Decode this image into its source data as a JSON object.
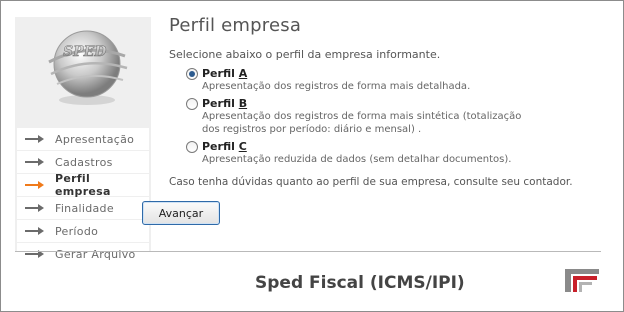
{
  "app": {
    "footer_title": "Sped Fiscal (ICMS/IPI)",
    "logo_text": "SPED"
  },
  "sidebar": {
    "items": [
      {
        "label": "Apresentação",
        "active": false
      },
      {
        "label": "Cadastros",
        "active": false
      },
      {
        "label": "Perfil empresa",
        "active": true
      },
      {
        "label": "Finalidade",
        "active": false
      },
      {
        "label": "Período",
        "active": false
      },
      {
        "label": "Gerar Arquivo",
        "active": false
      }
    ]
  },
  "main": {
    "title": "Perfil empresa",
    "intro": "Selecione abaixo o perfil da empresa informante.",
    "options": [
      {
        "label_prefix": "Perfil ",
        "label_key": "A",
        "checked": true,
        "desc_lines": [
          "Apresentação dos registros de forma mais detalhada."
        ]
      },
      {
        "label_prefix": "Perfil ",
        "label_key": "B",
        "checked": false,
        "desc_lines": [
          "Apresentação dos registros de forma mais sintética (totalização",
          "dos registros por período: diário e mensal) ."
        ]
      },
      {
        "label_prefix": "Perfil ",
        "label_key": "C",
        "checked": false,
        "desc_lines": [
          "Apresentação reduzida de dados (sem detalhar documentos)."
        ]
      }
    ],
    "note": "Caso tenha dúvidas quanto ao perfil de sua empresa, consulte seu contador.",
    "next_button": "Avançar"
  },
  "colors": {
    "active_arrow": "#f07a1a",
    "inactive_arrow": "#6b6b6b",
    "button_border": "#2f6aa8",
    "brand_red": "#c8202a"
  }
}
